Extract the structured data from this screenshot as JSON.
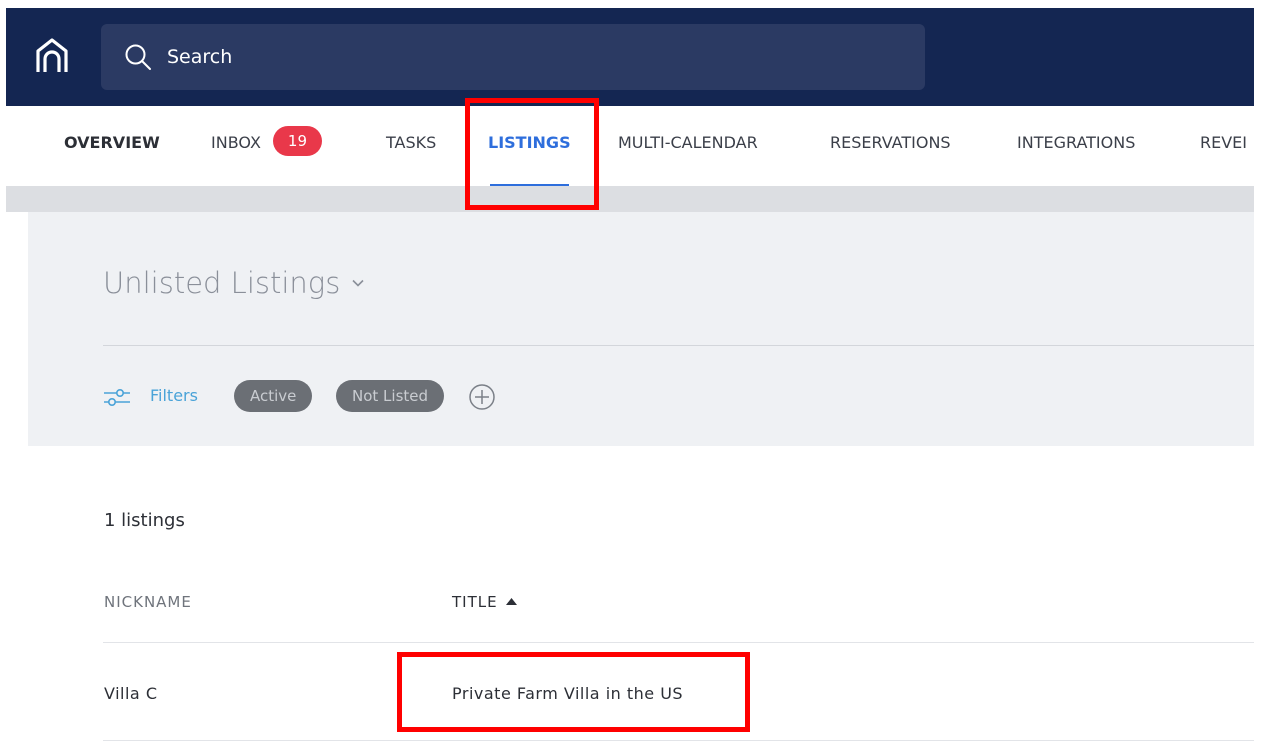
{
  "header": {
    "search_placeholder": "Search",
    "logo_icon": "home-outline-icon",
    "background_color": "#142652"
  },
  "nav": {
    "tabs": [
      {
        "label": "OVERVIEW"
      },
      {
        "label": "INBOX",
        "badge": "19"
      },
      {
        "label": "TASKS"
      },
      {
        "label": "LISTINGS",
        "active": true
      },
      {
        "label": "MULTI-CALENDAR"
      },
      {
        "label": "RESERVATIONS"
      },
      {
        "label": "INTEGRATIONS"
      },
      {
        "label": "REVEI"
      }
    ],
    "active_color": "#2e6edc",
    "badge_color": "#e9384a"
  },
  "listings": {
    "view_title": "Unlisted Listings",
    "view_chevron_icon": "chevron-down-icon",
    "filters": {
      "label": "Filters",
      "icon": "sliders-icon",
      "chips": [
        "Active",
        "Not Listed"
      ],
      "add_icon": "plus-circle-icon"
    },
    "count_text": "1 listings",
    "table": {
      "columns": [
        "NICKNAME",
        "TITLE"
      ],
      "sorted_column": "TITLE",
      "sort_direction": "ascending",
      "rows": [
        {
          "nickname": "Villa C",
          "title": "Private Farm Villa in the US"
        }
      ]
    }
  },
  "annotations": {
    "highlight_color": "#ff0000"
  }
}
